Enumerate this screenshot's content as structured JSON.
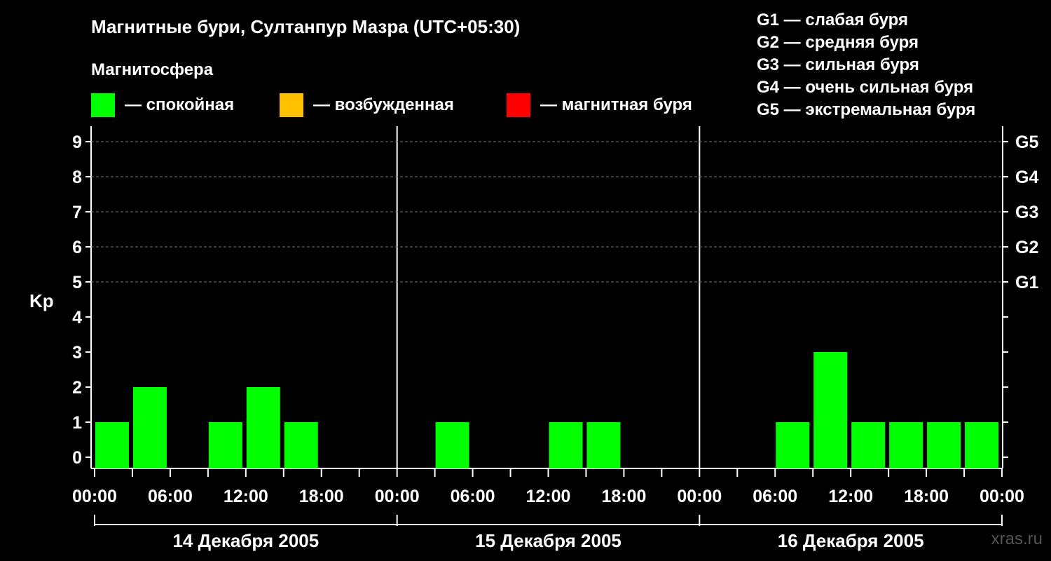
{
  "title": "Магнитные бури, Султанпур Мазра (UTC+05:30)",
  "legend": {
    "title": "Магнитосфера",
    "items": [
      {
        "label": "— спокойная",
        "color": "#00ff00"
      },
      {
        "label": "— возбужденная",
        "color": "#ffc000"
      },
      {
        "label": "— магнитная буря",
        "color": "#ff0000"
      }
    ]
  },
  "g_legend": [
    "G1 — слабая буря",
    "G2 — средняя буря",
    "G3 — сильная буря",
    "G4 — очень сильная буря",
    "G5 — экстремальная буря"
  ],
  "watermark": "xras.ru",
  "chart_data": {
    "type": "bar",
    "ylabel": "Kp",
    "ylim": [
      0,
      9
    ],
    "yticks": [
      "0",
      "1",
      "2",
      "3",
      "4",
      "5",
      "6",
      "7",
      "8",
      "9"
    ],
    "right_axis_labels": [
      {
        "y": 5,
        "label": "G1"
      },
      {
        "y": 6,
        "label": "G2"
      },
      {
        "y": 7,
        "label": "G3"
      },
      {
        "y": 8,
        "label": "G4"
      },
      {
        "y": 9,
        "label": "G5"
      }
    ],
    "xtick_labels": [
      "00:00",
      "06:00",
      "12:00",
      "18:00",
      "00:00",
      "06:00",
      "12:00",
      "18:00",
      "00:00",
      "06:00",
      "12:00",
      "18:00",
      "00:00"
    ],
    "days": [
      "14 Декабря 2005",
      "15 Декабря 2005",
      "16 Декабря 2005"
    ],
    "interval_hours": 3,
    "grid": "dashed horizontal at 5, 6, 7, 8, 9",
    "colors": {
      "quiet": "#00ff00",
      "active": "#ffc000",
      "storm": "#ff0000"
    },
    "values": [
      1,
      2,
      0,
      1,
      2,
      1,
      0,
      0,
      0,
      1,
      0,
      0,
      1,
      1,
      0,
      0,
      0,
      0,
      1,
      3,
      1,
      1,
      1,
      1
    ],
    "status": [
      "quiet",
      "quiet",
      "quiet",
      "quiet",
      "quiet",
      "quiet",
      "quiet",
      "quiet",
      "quiet",
      "quiet",
      "quiet",
      "quiet",
      "quiet",
      "quiet",
      "quiet",
      "quiet",
      "quiet",
      "quiet",
      "quiet",
      "quiet",
      "quiet",
      "quiet",
      "quiet",
      "quiet"
    ]
  }
}
